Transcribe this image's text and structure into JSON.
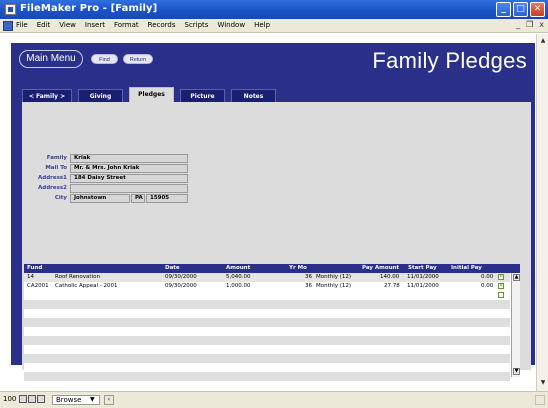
{
  "window": {
    "title": "FileMaker Pro - [Family]",
    "minimize": "_",
    "maximize": "□",
    "close": "✕"
  },
  "menubar": {
    "items": [
      "File",
      "Edit",
      "View",
      "Insert",
      "Format",
      "Records",
      "Scripts",
      "Window",
      "Help"
    ],
    "mdi_minimize": "_",
    "mdi_restore": "❐",
    "mdi_close": "x"
  },
  "header": {
    "main_menu": "Main Menu",
    "find": "Find",
    "return": "Return",
    "heading": "Family Pledges"
  },
  "tabs": [
    {
      "label": "<  Family  >",
      "active": false
    },
    {
      "label": "Giving",
      "active": false
    },
    {
      "label": "Pledges",
      "active": true
    },
    {
      "label": "Picture",
      "active": false
    },
    {
      "label": "Notes",
      "active": false
    }
  ],
  "record": {
    "family_label": "Family",
    "family": "Kriak",
    "mailto_label": "Mail To",
    "mailto": "Mr. & Mrs. John Kriak",
    "address1_label": "Address1",
    "address1": "184 Daisy Street",
    "address2_label": "Address2",
    "address2": "",
    "city_label": "City",
    "city": "Johnstown",
    "state": "PA",
    "zip": "15905"
  },
  "portal": {
    "headers": {
      "fund": "Fund",
      "date": "Date",
      "amount": "Amount",
      "yrmo": "Yr Mo",
      "pay_amount": "Pay Amount",
      "start_pay": "Start Pay",
      "initial_pay": "Initial Pay"
    },
    "rows": [
      {
        "fund_code": "14",
        "fund_name": "Roof Renovation",
        "date": "09/30/2000",
        "amount": "5,040.00",
        "yrmo": "36",
        "frequency": "Monthly (12)",
        "pay_amount": "140.00",
        "start_pay": "11/01/2000",
        "initial_pay": "0.00"
      },
      {
        "fund_code": "CA2001",
        "fund_name": "Catholic Appeal - 2001",
        "date": "09/30/2000",
        "amount": "1,000.00",
        "yrmo": "36",
        "frequency": "Monthly (12)",
        "pay_amount": "27.78",
        "start_pay": "11/01/2000",
        "initial_pay": "0.00"
      }
    ]
  },
  "statusbar": {
    "zoom": "100",
    "mode": "Browse"
  },
  "colors": {
    "brand_navy": "#2a2f89",
    "panel_grey": "#dcdcdc",
    "titlebar_blue": "#1b52c8"
  }
}
